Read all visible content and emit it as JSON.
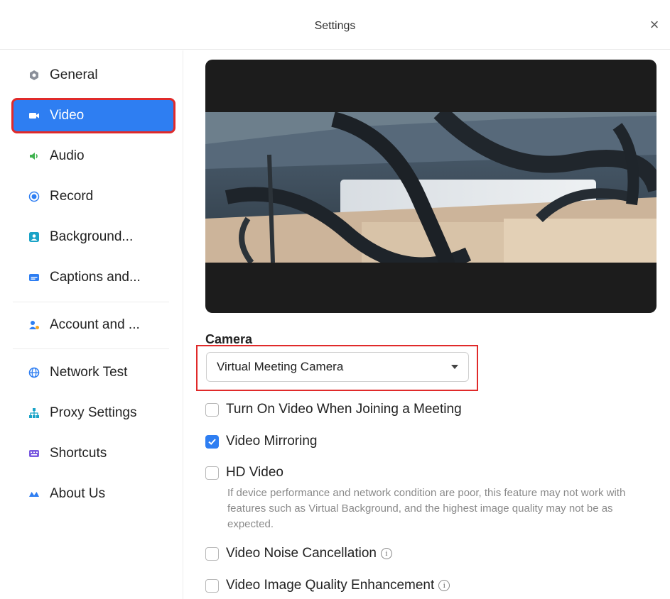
{
  "window": {
    "title": "Settings"
  },
  "sidebar": {
    "items": [
      {
        "label": "General",
        "icon": "gear-icon",
        "active": false
      },
      {
        "label": "Video",
        "icon": "video-camera-icon",
        "active": true
      },
      {
        "label": "Audio",
        "icon": "speaker-icon",
        "active": false
      },
      {
        "label": "Record",
        "icon": "record-icon",
        "active": false
      },
      {
        "label": "Background...",
        "icon": "background-icon",
        "active": false
      },
      {
        "label": "Captions and...",
        "icon": "captions-icon",
        "active": false
      },
      {
        "label": "Account and ...",
        "icon": "account-icon",
        "active": false
      },
      {
        "label": "Network Test",
        "icon": "globe-icon",
        "active": false
      },
      {
        "label": "Proxy Settings",
        "icon": "network-tree-icon",
        "active": false
      },
      {
        "label": "Shortcuts",
        "icon": "keyboard-icon",
        "active": false
      },
      {
        "label": "About Us",
        "icon": "logo-icon",
        "active": false
      }
    ]
  },
  "camera": {
    "label": "Camera",
    "selected": "Virtual Meeting Camera"
  },
  "options": {
    "turn_on_video": {
      "label": "Turn On Video When Joining a Meeting",
      "checked": false
    },
    "mirroring": {
      "label": "Video Mirroring",
      "checked": true
    },
    "hd_video": {
      "label": "HD Video",
      "checked": false,
      "hint": "If device performance and network condition are poor, this feature may not work with features such as Virtual Background, and the highest image quality may not be as expected."
    },
    "noise_cancellation": {
      "label": "Video Noise Cancellation",
      "checked": false
    },
    "quality_enhancement": {
      "label": "Video Image Quality Enhancement",
      "checked": false
    }
  },
  "colors": {
    "accent": "#2e7ef2",
    "highlight": "#e02a2a"
  }
}
